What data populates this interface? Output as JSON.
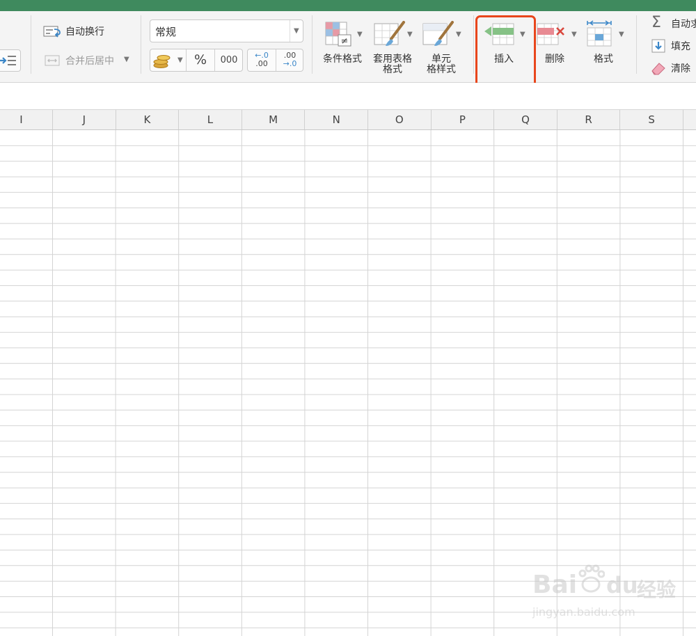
{
  "ribbon": {
    "wrap_text_label": "自动换行",
    "merge_center_label": "合并后居中",
    "number_format_value": "常规",
    "percent_symbol": "%",
    "thousands_label": "000",
    "increase_decimal_top": "←.0",
    "increase_decimal_bottom": ".00",
    "decrease_decimal_top": ".00",
    "decrease_decimal_bottom": "→.0",
    "conditional_format_label": "条件格式",
    "table_format_line1": "套用表格",
    "table_format_line2": "格式",
    "cell_style_line1": "单元",
    "cell_style_line2": "格样式",
    "insert_label": "插入",
    "delete_label": "删除",
    "format_label": "格式",
    "autosum_label": "自动求",
    "fill_label": "填充",
    "clear_label": "清除"
  },
  "columns": [
    "I",
    "J",
    "K",
    "L",
    "M",
    "N",
    "O",
    "P",
    "Q",
    "R",
    "S"
  ],
  "watermark": {
    "brand_left": "Bai",
    "brand_right": "du",
    "brand_cn": "经验",
    "url": "jingyan.baidu.com"
  },
  "colors": {
    "title_bar": "#3f8a5e",
    "highlight": "#e8461c",
    "grid_line": "#d4d4d4"
  }
}
